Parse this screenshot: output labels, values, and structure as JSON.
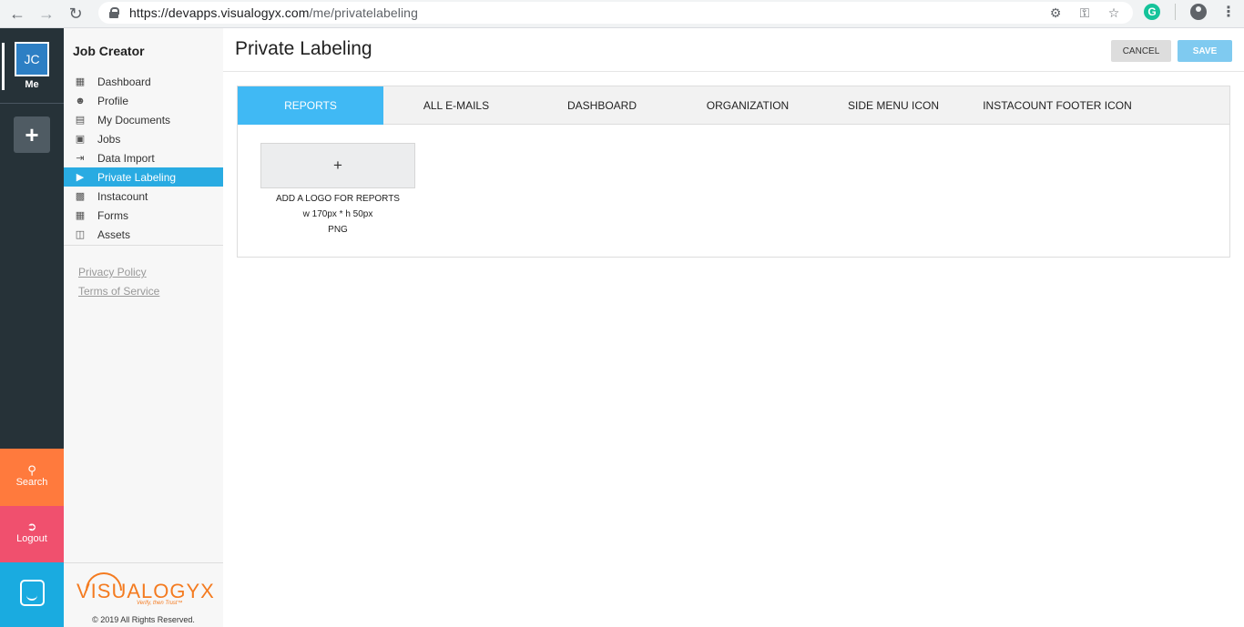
{
  "browser": {
    "url_host": "https://devapps.visualogyx.com",
    "url_path": "/me/privatelabeling"
  },
  "rail": {
    "avatar_initials": "JC",
    "me_label": "Me",
    "add_label": "+",
    "search_label": "Search",
    "logout_label": "Logout"
  },
  "sidebar": {
    "title": "Job Creator",
    "items": [
      {
        "label": "Dashboard",
        "icon": "dashboard-icon"
      },
      {
        "label": "Profile",
        "icon": "profile-icon"
      },
      {
        "label": "My Documents",
        "icon": "documents-icon"
      },
      {
        "label": "Jobs",
        "icon": "briefcase-icon"
      },
      {
        "label": "Data Import",
        "icon": "import-icon"
      },
      {
        "label": "Private Labeling",
        "icon": "tag-icon"
      },
      {
        "label": "Instacount",
        "icon": "instacount-icon"
      },
      {
        "label": "Forms",
        "icon": "form-icon"
      },
      {
        "label": "Assets",
        "icon": "assets-icon"
      }
    ],
    "links": {
      "privacy": "Privacy Policy",
      "terms": "Terms of Service"
    },
    "logo": {
      "text": "VISUALOGYX",
      "tagline": "Verify, then Trust™"
    },
    "copyright": "© 2019 All Rights Reserved."
  },
  "main": {
    "title": "Private Labeling",
    "cancel_label": "CANCEL",
    "save_label": "SAVE",
    "tabs": [
      "REPORTS",
      "ALL E-MAILS",
      "DASHBOARD",
      "ORGANIZATION",
      "SIDE MENU ICON",
      "INSTACOUNT FOOTER ICON"
    ],
    "active_tab": "REPORTS",
    "upload": {
      "plus": "+",
      "line1": "ADD A LOGO FOR REPORTS",
      "line2": "w 170px * h 50px",
      "line3": "PNG"
    }
  },
  "colors": {
    "accent": "#29abe2",
    "tab_active": "#40b9f4",
    "search_tile": "#ff7a3d",
    "logout_tile": "#f0506e",
    "brand": "#f47b20"
  }
}
